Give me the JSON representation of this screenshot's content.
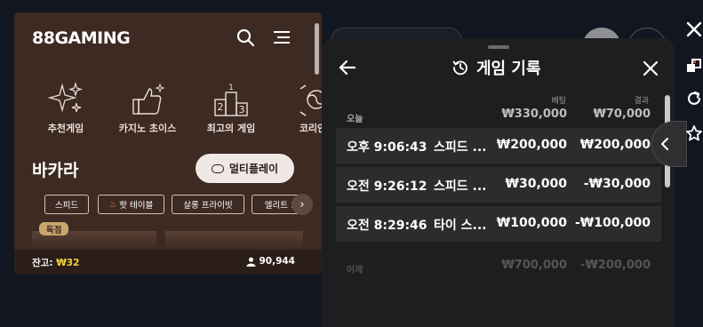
{
  "app": {
    "logo": "88GAMING",
    "categories": [
      {
        "label": "추천게임",
        "icon": "sparkles-icon"
      },
      {
        "label": "카지노 초이스",
        "icon": "thumbs-up-icon"
      },
      {
        "label": "최고의 게임",
        "icon": "podium-icon"
      },
      {
        "label": "코리안",
        "icon": "korean-flag-icon"
      }
    ],
    "section_title": "바카라",
    "multiplay_label": "멀티플레이",
    "chips": [
      "스피드",
      "핫 테이블",
      "살롱 프라이빗",
      "엘리트 :"
    ],
    "exclusive_badge": "독점",
    "balance_label": "잔고:",
    "balance_value": "₩32",
    "player_count": "90,944"
  },
  "history": {
    "title": "게임 기록",
    "col_bet": "베팅",
    "col_result": "결과",
    "groups": [
      {
        "label": "오늘",
        "bet_total": "₩330,000",
        "result_total": "₩70,000"
      },
      {
        "label": "어제",
        "bet_total": "₩700,000",
        "result_total": "-₩200,000"
      }
    ],
    "rows": [
      {
        "time": "오후 9:06:43",
        "game": "스피드 ...",
        "bet": "₩200,000",
        "result": "₩200,000"
      },
      {
        "time": "오전 9:26:12",
        "game": "스피드 ...",
        "bet": "₩30,000",
        "result": "-₩30,000"
      },
      {
        "time": "오전 8:29:46",
        "game": "타이 스...",
        "bet": "₩100,000",
        "result": "-₩100,000"
      }
    ]
  },
  "toolbar": [
    "close-icon",
    "popout-icon",
    "refresh-icon",
    "star-icon"
  ],
  "colors": {
    "app_bg": "#3d2a22",
    "panel_bg": "#1e1e20",
    "row_bg": "#2c2c2f",
    "balance": "#f4d03f",
    "badge": "#c9a66b"
  }
}
